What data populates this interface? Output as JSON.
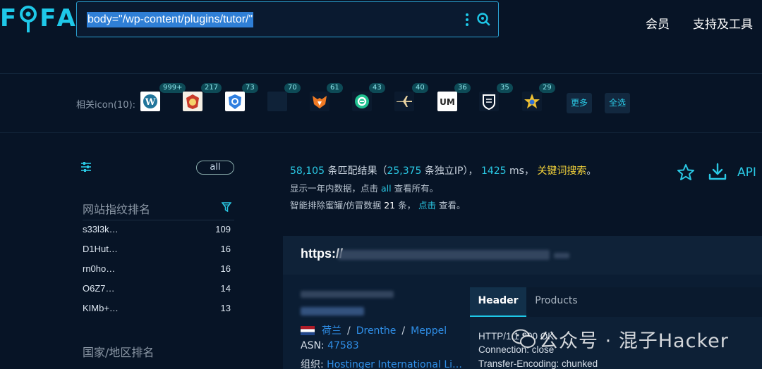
{
  "header": {
    "logo_parts": [
      "F",
      "F",
      "A"
    ],
    "search_query": "body=\"/wp-content/plugins/tutor/\"",
    "nav": [
      "会员",
      "支持及工具"
    ]
  },
  "icons": {
    "label": "相关icon(10):",
    "items": [
      {
        "name": "wordpress-icon",
        "count": "999+"
      },
      {
        "name": "badge-icon",
        "count": "217"
      },
      {
        "name": "shield-blue-icon",
        "count": "73"
      },
      {
        "name": "blank-icon",
        "count": "70"
      },
      {
        "name": "fox-icon",
        "count": "61"
      },
      {
        "name": "green-circle-icon",
        "count": "43"
      },
      {
        "name": "airplane-icon",
        "count": "40"
      },
      {
        "name": "um-icon",
        "count": "36"
      },
      {
        "name": "crest-icon",
        "count": "35"
      },
      {
        "name": "star-badge-icon",
        "count": "29"
      }
    ],
    "more": "更多",
    "select_all": "全选"
  },
  "sidebar": {
    "all_label": "all",
    "fingerprint_title": "网站指纹排名",
    "fingerprint_items": [
      {
        "label": "s33l3k…",
        "count": "109"
      },
      {
        "label": "D1Hut…",
        "count": "16"
      },
      {
        "label": "rn0ho…",
        "count": "16"
      },
      {
        "label": "O6Z7…",
        "count": "14"
      },
      {
        "label": "KIMb+…",
        "count": "13"
      }
    ],
    "country_title": "国家/地区排名"
  },
  "summary": {
    "total": "58,105",
    "total_text": " 条匹配结果（",
    "unique_ip": "25,375",
    "unique_ip_text": " 条独立IP）， ",
    "time": "1425",
    "time_text": " ms， ",
    "keyword_search": "关键词搜索",
    "period": "。",
    "line2_prefix": "显示一年内数据，点击 ",
    "line2_link": "all",
    "line2_suffix": " 查看所有。",
    "line3_prefix": "智能排除蜜罐/仿冒数据 ",
    "line3_num": "21",
    "line3_mid": " 条， ",
    "line3_link": "点击",
    "line3_suffix": " 查看。",
    "api_label": "API"
  },
  "result": {
    "url_prefix": "https://",
    "location": {
      "country": "荷兰",
      "region": "Drenthe",
      "city": "Meppel"
    },
    "asn_label": "ASN: ",
    "asn": "47583",
    "org_label": "组织: ",
    "org": "Hostinger International Li…",
    "tabs": [
      "Header",
      "Products"
    ],
    "header_lines": [
      "HTTP/1.1 200 OK",
      "Connection: close",
      "Transfer-Encoding: chunked"
    ]
  },
  "watermark": "公众号 · 混子Hacker",
  "colors": {
    "accent": "#1ec8e8",
    "background": "#071426",
    "keyword": "#f3d23a",
    "link": "#2f8fe8"
  }
}
